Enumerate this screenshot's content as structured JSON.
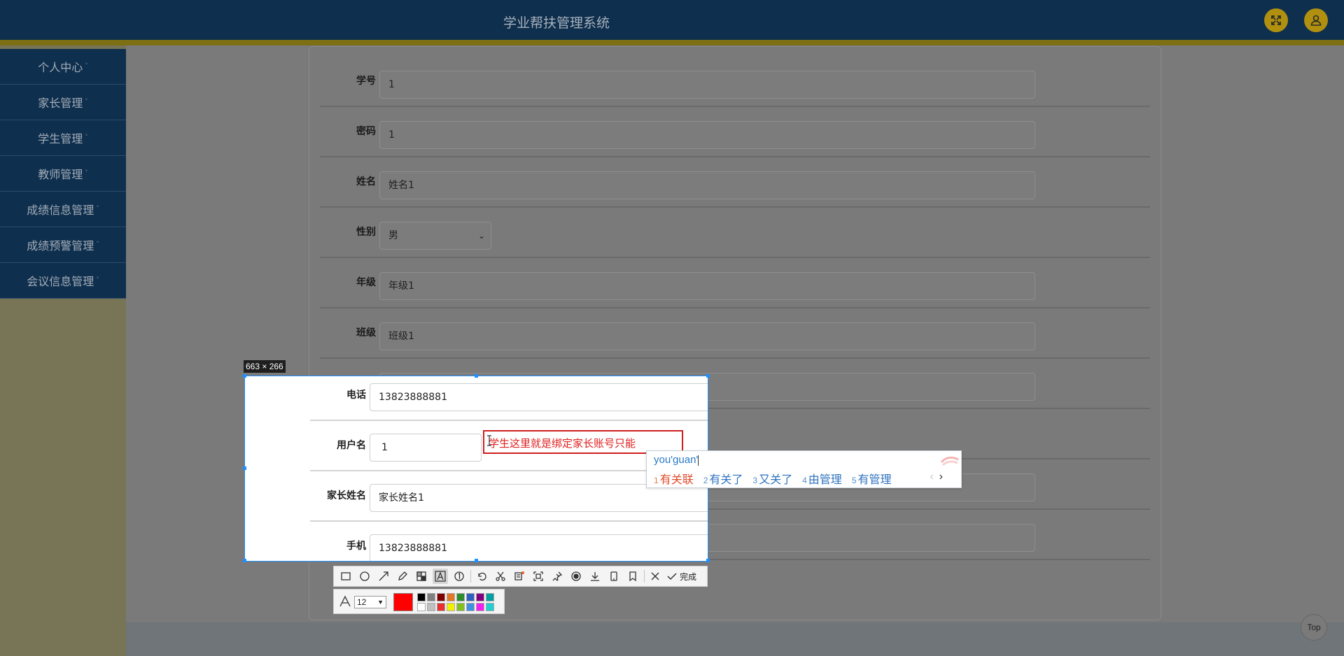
{
  "header": {
    "title": "学业帮扶管理系统",
    "fullscreen_icon": "fullscreen-icon",
    "user_icon": "user-icon"
  },
  "sidebar": {
    "items": [
      {
        "label": "个人中心"
      },
      {
        "label": "家长管理"
      },
      {
        "label": "学生管理"
      },
      {
        "label": "教师管理"
      },
      {
        "label": "成绩信息管理"
      },
      {
        "label": "成绩预警管理"
      },
      {
        "label": "会议信息管理"
      }
    ]
  },
  "form": {
    "fields": [
      {
        "label": "学号",
        "value": "1"
      },
      {
        "label": "密码",
        "value": "1"
      },
      {
        "label": "姓名",
        "value": "姓名1"
      },
      {
        "label": "性别",
        "value": "男"
      },
      {
        "label": "年级",
        "value": "年级1"
      },
      {
        "label": "班级",
        "value": "班级1"
      },
      {
        "label": "电话",
        "value": "13823888881"
      },
      {
        "label": "用户名",
        "value": "1"
      },
      {
        "label": "家长姓名",
        "value": "家长姓名1"
      },
      {
        "label": "手机",
        "value": "13823888881"
      }
    ]
  },
  "screenshot_tool": {
    "selection_size": "663 × 266",
    "annotation_text": "学生这里就是绑定家长账号只能",
    "done_label": "完成",
    "font_size": "12",
    "current_color": "#ff0000",
    "palette": [
      "#000000",
      "#808080",
      "#800000",
      "#e07828",
      "#2e8b2e",
      "#2f5fbf",
      "#800080",
      "#00a0a0",
      "#ffffff",
      "#c0c0c0",
      "#e83030",
      "#f0f000",
      "#80c020",
      "#4090e0",
      "#f020f0",
      "#20d0d0"
    ]
  },
  "ime": {
    "composition": "you'guan'",
    "candidates": [
      {
        "num": "1",
        "text": "有关联"
      },
      {
        "num": "2",
        "text": "有关了"
      },
      {
        "num": "3",
        "text": "又关了"
      },
      {
        "num": "4",
        "text": "由管理"
      },
      {
        "num": "5",
        "text": "有管理"
      }
    ],
    "prev": "‹",
    "next": "›"
  },
  "top_button": {
    "label": "Top"
  }
}
